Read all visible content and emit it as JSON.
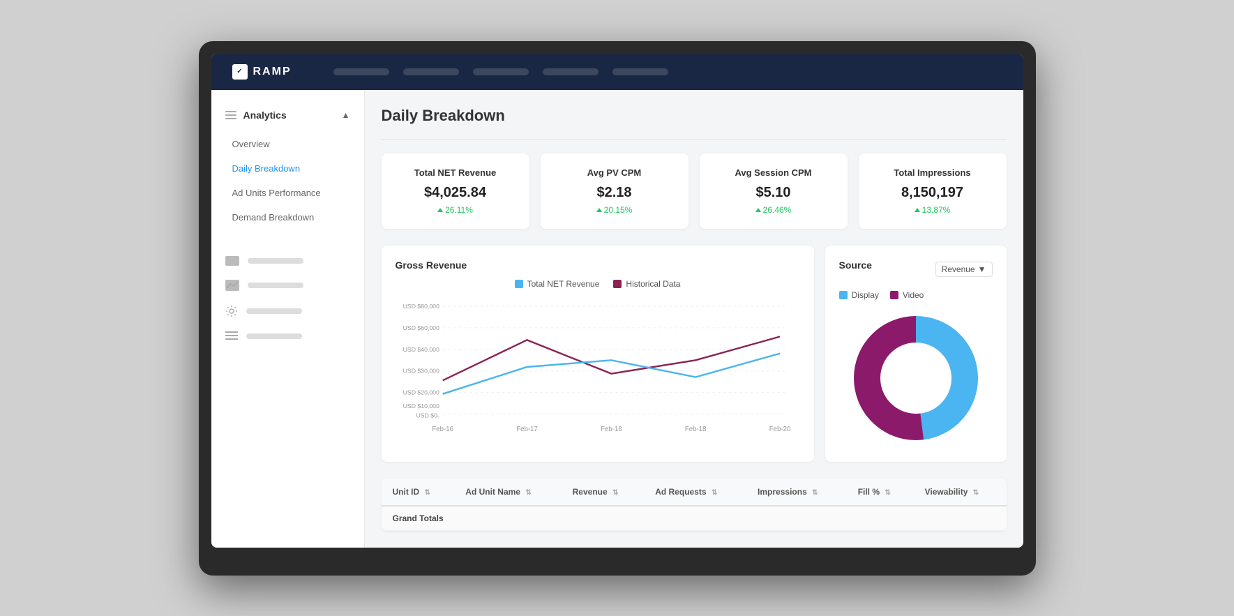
{
  "nav": {
    "logo_text": "RAMP",
    "items": [
      "",
      "",
      "",
      "",
      ""
    ]
  },
  "sidebar": {
    "analytics_label": "Analytics",
    "nav_items": [
      {
        "label": "Overview",
        "active": false
      },
      {
        "label": "Daily Breakdown",
        "active": true
      },
      {
        "label": "Ad Units Performance",
        "active": false
      },
      {
        "label": "Demand Breakdown",
        "active": false
      }
    ],
    "other_items": [
      {
        "icon": "video-icon"
      },
      {
        "icon": "chart-icon"
      },
      {
        "icon": "gear-icon"
      },
      {
        "icon": "list-icon"
      }
    ]
  },
  "page": {
    "title": "Daily Breakdown",
    "metrics": [
      {
        "label": "Total NET Revenue",
        "value": "$4,025.84",
        "change": "26.11%"
      },
      {
        "label": "Avg PV CPM",
        "value": "$2.18",
        "change": "20.15%"
      },
      {
        "label": "Avg Session CPM",
        "value": "$5.10",
        "change": "26.46%"
      },
      {
        "label": "Total Impressions",
        "value": "8,150,197",
        "change": "13.87%"
      }
    ],
    "gross_revenue_chart": {
      "title": "Gross Revenue",
      "legend": [
        {
          "label": "Total NET Revenue",
          "color": "#4ab5f0"
        },
        {
          "label": "Historical Data",
          "color": "#8b2252"
        }
      ],
      "x_labels": [
        "Feb-16",
        "Feb-17",
        "Feb-18",
        "Feb-18",
        "Feb-20"
      ],
      "y_labels": [
        "USD $80,000",
        "USD $60,000",
        "USD $40,000",
        "USD $20,000",
        "USD $10,000",
        "USD $0-"
      ]
    },
    "source_chart": {
      "title": "Source",
      "dropdown_value": "Revenue",
      "legend": [
        {
          "label": "Display",
          "color": "#4ab5f0"
        },
        {
          "label": "Video",
          "color": "#8b1a6b"
        }
      ],
      "display_pct": 48,
      "video_pct": 52
    },
    "table": {
      "columns": [
        {
          "label": "Unit ID",
          "sortable": true
        },
        {
          "label": "Ad Unit Name",
          "sortable": true
        },
        {
          "label": "Revenue",
          "sortable": true
        },
        {
          "label": "Ad Requests",
          "sortable": true
        },
        {
          "label": "Impressions",
          "sortable": true
        },
        {
          "label": "Fill %",
          "sortable": true
        },
        {
          "label": "Viewability",
          "sortable": true
        }
      ],
      "grand_totals_label": "Grand Totals"
    }
  }
}
